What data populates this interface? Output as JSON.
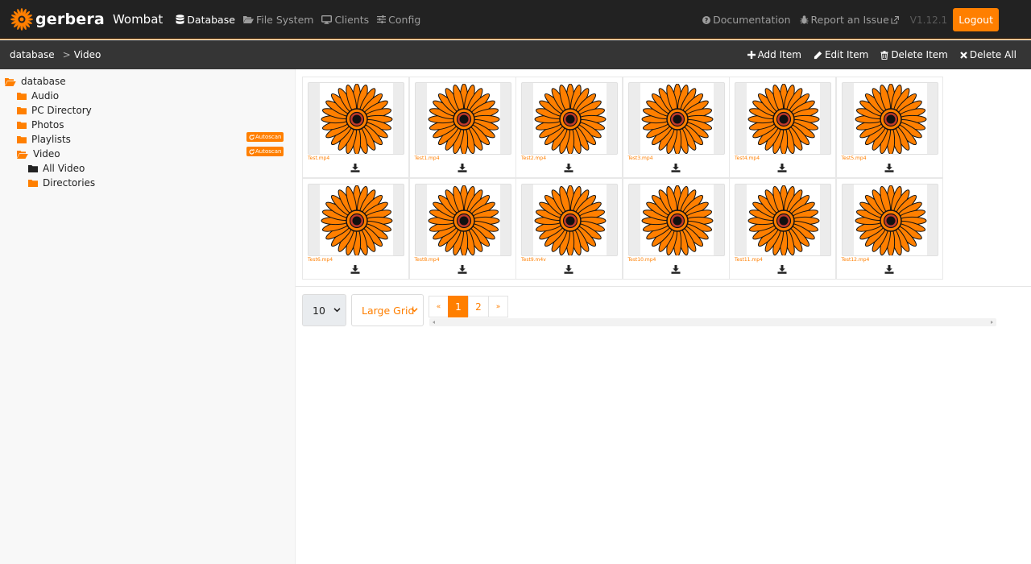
{
  "app": {
    "brand": "gerbera",
    "subtitle": "Wombat",
    "logo_icon": "gerbera-flower-icon",
    "accent_color": "#ff7f00",
    "navbar_color": "#222222"
  },
  "nav": {
    "links": [
      {
        "label": "Database",
        "icon": "database-icon",
        "active": true
      },
      {
        "label": "File System",
        "icon": "folder-open-icon",
        "active": false
      },
      {
        "label": "Clients",
        "icon": "desktop-icon",
        "active": false
      },
      {
        "label": "Config",
        "icon": "sliders-icon",
        "active": false
      }
    ],
    "right": {
      "documentation": "Documentation",
      "report": "Report an Issue",
      "version": "V1.12.1",
      "logout": "Logout"
    }
  },
  "breadcrumb": {
    "items": [
      "database",
      "Video"
    ],
    "separator": ">"
  },
  "toolbar": {
    "add": "Add Item",
    "edit": "Edit Item",
    "delete": "Delete Item",
    "delete_all": "Delete All"
  },
  "tree": {
    "root": "database",
    "items": [
      {
        "label": "Audio"
      },
      {
        "label": "PC Directory"
      },
      {
        "label": "Photos"
      },
      {
        "label": "Playlists",
        "badge": "Autoscan"
      },
      {
        "label": "Video",
        "badge": "Autoscan"
      }
    ],
    "video_children": [
      "All Video",
      "Directories"
    ]
  },
  "items": [
    {
      "title": "Test.mp4"
    },
    {
      "title": "Test1.mp4"
    },
    {
      "title": "Test2.mp4"
    },
    {
      "title": "Test3.mp4"
    },
    {
      "title": "Test4.mp4"
    },
    {
      "title": "Test5.mp4"
    },
    {
      "title": "Test6.mp4"
    },
    {
      "title": "Test8.mp4"
    },
    {
      "title": "Test9.m4v"
    },
    {
      "title": "Test10.mp4"
    },
    {
      "title": "Test11.mp4"
    },
    {
      "title": "Test12.mp4"
    }
  ],
  "pagination": {
    "items_per_page": "10",
    "view_mode": "Large Grid",
    "first": "«",
    "pages": [
      "1",
      "2"
    ],
    "current": "1",
    "last": "»"
  }
}
